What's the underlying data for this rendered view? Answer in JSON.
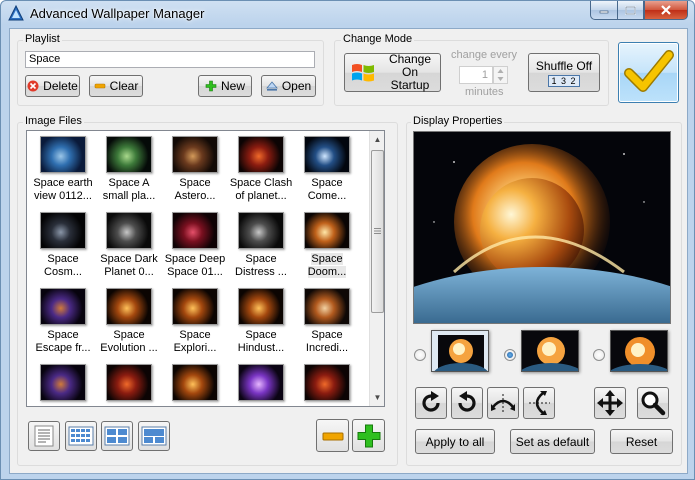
{
  "window": {
    "title": "Advanced Wallpaper Manager"
  },
  "playlist": {
    "group_label": "Playlist",
    "current_value": "Space",
    "delete_label": "Delete",
    "clear_label": "Clear",
    "new_label": "New",
    "open_label": "Open"
  },
  "change_mode": {
    "group_label": "Change Mode",
    "change_on_startup_label": "Change On Startup",
    "change_every_label": "change every",
    "interval_value": "1",
    "minutes_label": "minutes",
    "shuffle_label": "Shuffle Off",
    "shuffle_icon_text": "1 3 2"
  },
  "apply_button": {
    "icon": "checkmark-icon"
  },
  "image_files": {
    "group_label": "Image Files",
    "items": [
      {
        "caption": "Space  earth view 0112...",
        "palette": "earth"
      },
      {
        "caption": "Space A small pla...",
        "palette": "green"
      },
      {
        "caption": "Space Astero...",
        "palette": "brown"
      },
      {
        "caption": "Space Clash of planet...",
        "palette": "red"
      },
      {
        "caption": "Space Come...",
        "palette": "blue"
      },
      {
        "caption": "Space Cosm...",
        "palette": "dark"
      },
      {
        "caption": "Space Dark Planet 0...",
        "palette": "gray"
      },
      {
        "caption": "Space Deep Space 01...",
        "palette": "crimson"
      },
      {
        "caption": "Space Distress ...",
        "palette": "gray"
      },
      {
        "caption": "Space Doom...",
        "palette": "explosion"
      },
      {
        "caption": "Space Escape fr...",
        "palette": "purple"
      },
      {
        "caption": "Space Evolution ...",
        "palette": "orange"
      },
      {
        "caption": "Space Explori...",
        "palette": "orange"
      },
      {
        "caption": "Space Hindust...",
        "palette": "orange"
      },
      {
        "caption": "Space Incredi...",
        "palette": "sunset"
      },
      {
        "caption": "",
        "palette": "purple"
      },
      {
        "caption": "",
        "palette": "red"
      },
      {
        "caption": "",
        "palette": "orange"
      },
      {
        "caption": "",
        "palette": "violet"
      },
      {
        "caption": "",
        "palette": "red"
      }
    ]
  },
  "view_buttons": [
    {
      "name": "view-details-button",
      "icon": "details-view-icon"
    },
    {
      "name": "view-small-grid-button",
      "icon": "small-grid-icon"
    },
    {
      "name": "view-medium-grid-button",
      "icon": "medium-grid-icon"
    },
    {
      "name": "view-large-grid-button",
      "icon": "large-grid-icon"
    }
  ],
  "display_properties": {
    "group_label": "Display Properties",
    "position_options": [
      "center",
      "tile",
      "stretch"
    ],
    "selected_position": "tile",
    "apply_to_all_label": "Apply to all",
    "set_default_label": "Set as default",
    "reset_label": "Reset"
  },
  "colors": {
    "accent": "#1d5fa8",
    "remove_orange": "#f0a400",
    "add_green": "#2fbf1f",
    "checkmark_yellow": "#f6c400"
  }
}
